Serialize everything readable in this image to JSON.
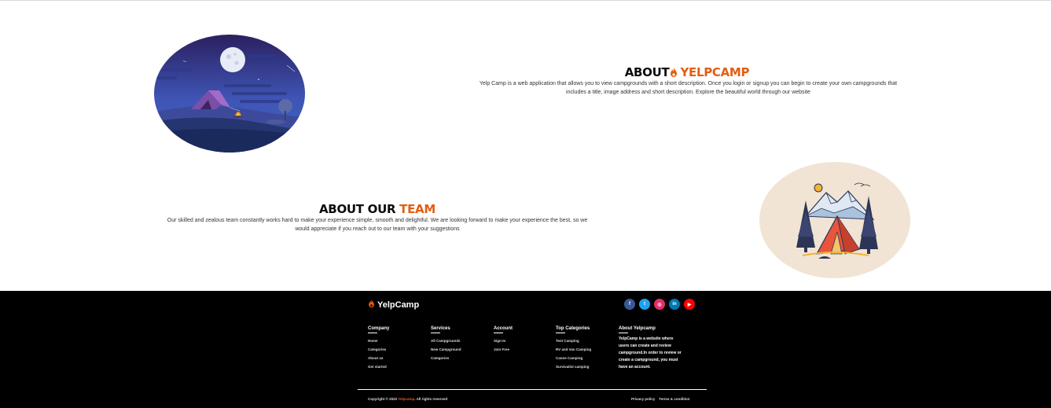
{
  "about_yelpcamp": {
    "title_prefix": "ABOUT",
    "title_accent": "YELPCAMP",
    "description": "Yelp Camp is a web application that allows you to view campgrounds with a short description. Once you login or signup you can begin to create your own campgrounds that includes a title, image address and short description. Explore the beautiful world through our website"
  },
  "about_team": {
    "title_prefix": "ABOUT OUR",
    "title_accent": "TEAM",
    "description": "Our skilled and zealous team constantly works hard to make your experience simple, smooth and delightful. We are looking forward to make your experience the best, so we would appreciate if you reach out to our team with your suggestions"
  },
  "footer": {
    "brand": "YelpCamp",
    "socials": [
      {
        "icon": "facebook-icon",
        "glyph": "f",
        "color": "#3b5998"
      },
      {
        "icon": "twitter-icon",
        "glyph": "t",
        "color": "#1da1f2"
      },
      {
        "icon": "instagram-icon",
        "glyph": "◎",
        "color": "#e1306c"
      },
      {
        "icon": "linkedin-icon",
        "glyph": "in",
        "color": "#0077b5"
      },
      {
        "icon": "youtube-icon",
        "glyph": "▶",
        "color": "#ff0000"
      }
    ],
    "columns": {
      "company": {
        "heading": "Company",
        "items": [
          "Home",
          "Categories",
          "About us",
          "Get started"
        ]
      },
      "services": {
        "heading": "Services",
        "items": [
          "All Campgrounds",
          "New Campground",
          "Categories"
        ]
      },
      "account": {
        "heading": "Account",
        "items": [
          "Sign-In",
          "Join Free"
        ]
      },
      "top_categories": {
        "heading": "Top Categories",
        "items": [
          "Tent Camping",
          "RV and Van Camping",
          "Canoe Camping",
          "Survivalist camping"
        ]
      },
      "about": {
        "heading": "About Yelpcamp",
        "text": "YelpCamp is a website where users can create and review campground.In order to review or create a campground, you must have an account."
      }
    },
    "copyright_prefix": "Copyright © 2022",
    "copyright_brand": "Yelpcamp",
    "copyright_suffix": ". All rights reserved",
    "privacy": "Privacy policy",
    "terms": "Terms & condition"
  },
  "colors": {
    "accent": "#e35d12",
    "footer_bg": "#000000"
  }
}
